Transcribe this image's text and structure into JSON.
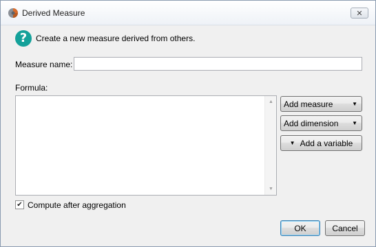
{
  "window": {
    "title": "Derived Measure",
    "close_glyph": "✕",
    "icon": "app-logo-icon"
  },
  "header": {
    "help_glyph": "?",
    "description": "Create a new measure derived from others."
  },
  "measure_name": {
    "label": "Measure name:",
    "value": "",
    "placeholder": ""
  },
  "formula": {
    "label": "Formula:",
    "value": ""
  },
  "side_buttons": {
    "add_measure": "Add measure",
    "add_dimension": "Add dimension",
    "add_variable": "Add a variable",
    "caret": "▼"
  },
  "options": {
    "compute_after_aggregation_label": "Compute after aggregation",
    "compute_after_aggregation_checked": true,
    "check_glyph": "✔"
  },
  "footer": {
    "ok": "OK",
    "cancel": "Cancel"
  },
  "colors": {
    "help_icon": "#14a19a",
    "ok_border": "#3c7fb1"
  }
}
